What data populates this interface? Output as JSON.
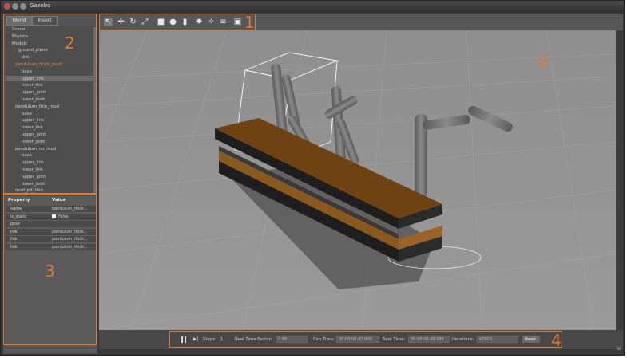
{
  "window": {
    "title": "Gazebo"
  },
  "left_panel": {
    "tabs": [
      "World",
      "Insert"
    ],
    "tree": [
      {
        "label": "Scene",
        "indent": 1
      },
      {
        "label": "Physics",
        "indent": 1
      },
      {
        "label": "Models",
        "indent": 1
      },
      {
        "label": "ground_plane",
        "indent": 3
      },
      {
        "label": "link",
        "indent": 4
      },
      {
        "label": "pendulum_thick_mud",
        "indent": 2,
        "selected": true
      },
      {
        "label": "base",
        "indent": 4
      },
      {
        "label": "upper_link",
        "indent": 4
      },
      {
        "label": "lower_link",
        "indent": 4
      },
      {
        "label": "upper_joint",
        "indent": 4
      },
      {
        "label": "lower_joint",
        "indent": 4
      },
      {
        "label": "pendulum_thin_mud",
        "indent": 2
      },
      {
        "label": "base",
        "indent": 4
      },
      {
        "label": "upper_link",
        "indent": 4
      },
      {
        "label": "lower_link",
        "indent": 4
      },
      {
        "label": "upper_joint",
        "indent": 4
      },
      {
        "label": "lower_joint",
        "indent": 4
      },
      {
        "label": "pendulum_no_mud",
        "indent": 2
      },
      {
        "label": "base",
        "indent": 4
      },
      {
        "label": "upper_link",
        "indent": 4
      },
      {
        "label": "lower_link",
        "indent": 4
      },
      {
        "label": "upper_joint",
        "indent": 4
      },
      {
        "label": "lower_joint",
        "indent": 4
      },
      {
        "label": "mud_pit_thin",
        "indent": 2
      }
    ],
    "properties": {
      "header_property": "Property",
      "header_value": "Value",
      "rows": [
        {
          "name": "name",
          "value": "pendulum_thick..."
        },
        {
          "name": "is_static",
          "value": "False",
          "checkbox": true
        },
        {
          "name": "pose",
          "value": ""
        },
        {
          "name": "link",
          "value": "pendulum_thick..."
        },
        {
          "name": "link",
          "value": "pendulum_thick..."
        },
        {
          "name": "link",
          "value": "pendulum_thick..."
        }
      ]
    }
  },
  "toolbar": {
    "tools": [
      "select-arrow-icon",
      "translate-icon",
      "rotate-icon",
      "scale-icon",
      "box-icon",
      "sphere-icon",
      "cylinder-icon",
      "point-light-icon",
      "spot-light-icon",
      "directional-light-icon",
      "screenshot-icon"
    ]
  },
  "bottom_bar": {
    "steps_label": "Steps:",
    "steps_value": "1",
    "real_time_factor_label": "Real Time Factor:",
    "real_time_factor_value": "0.99",
    "sim_time_label": "Sim Time:",
    "sim_time_value": "00:00:00:47.800",
    "real_time_label": "Real Time:",
    "real_time_value": "00:00:00:49.586",
    "iterations_label": "Iterations:",
    "iterations_value": "47800",
    "reset_label": "Reset"
  },
  "annotations": [
    "0",
    "1",
    "2",
    "3",
    "4"
  ],
  "colors": {
    "annotation": "#e07832",
    "selection": "#f08040",
    "mud": "#7a4a14"
  }
}
